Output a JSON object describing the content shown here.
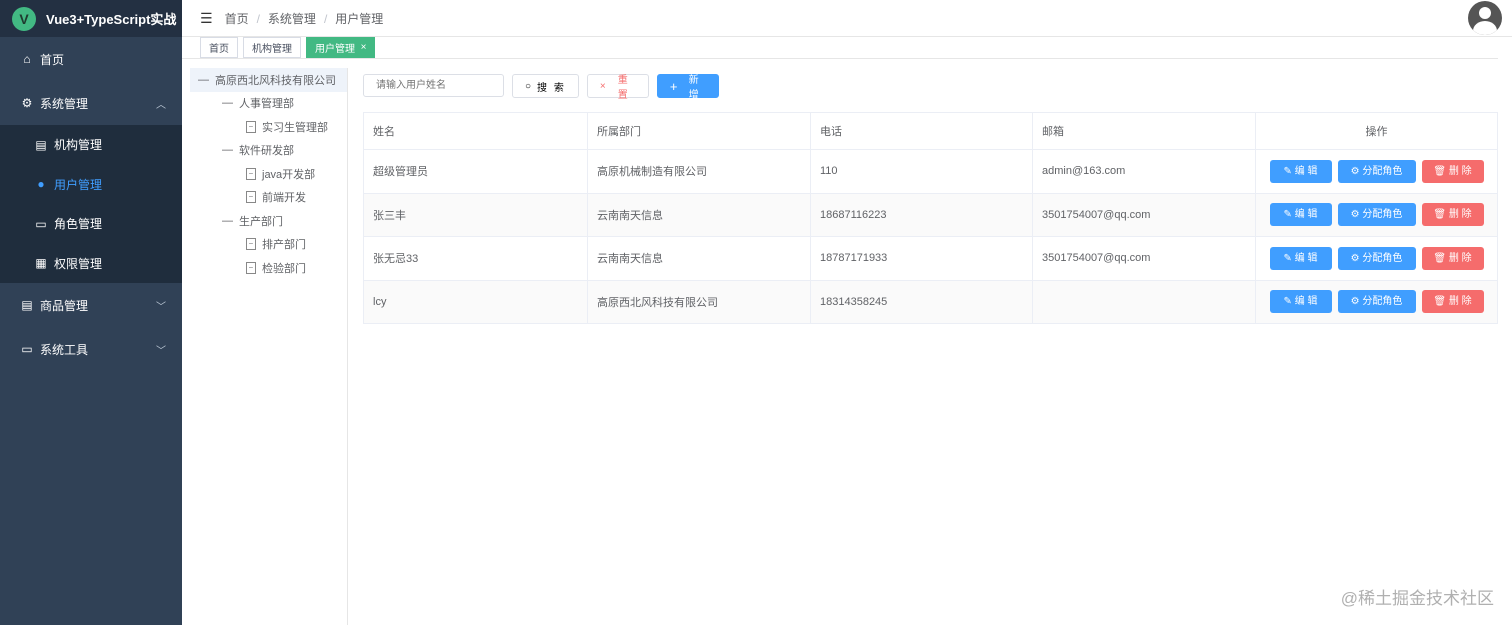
{
  "app": {
    "title": "Vue3+TypeScript实战",
    "logo_letter": "V"
  },
  "sidebar": {
    "items": [
      {
        "label": "首页",
        "icon": "home-icon"
      },
      {
        "label": "系统管理",
        "icon": "gear-icon",
        "expanded": true,
        "children": [
          {
            "label": "机构管理",
            "icon": "clipboard-icon"
          },
          {
            "label": "用户管理",
            "icon": "user-icon",
            "active": true
          },
          {
            "label": "角色管理",
            "icon": "folder-icon"
          },
          {
            "label": "权限管理",
            "icon": "grid-icon"
          }
        ]
      },
      {
        "label": "商品管理",
        "icon": "document-icon"
      },
      {
        "label": "系统工具",
        "icon": "message-icon"
      }
    ]
  },
  "breadcrumb": [
    "首页",
    "系统管理",
    "用户管理"
  ],
  "tabs": [
    {
      "label": "首页"
    },
    {
      "label": "机构管理"
    },
    {
      "label": "用户管理",
      "active": true,
      "close": "×"
    }
  ],
  "tree": [
    {
      "label": "高原西北风科技有限公司",
      "level": 0
    },
    {
      "label": "人事管理部",
      "level": 1
    },
    {
      "label": "实习生管理部",
      "level": 2
    },
    {
      "label": "软件研发部",
      "level": 1
    },
    {
      "label": "java开发部",
      "level": 2
    },
    {
      "label": "前端开发",
      "level": 2
    },
    {
      "label": "生产部门",
      "level": 1
    },
    {
      "label": "排产部门",
      "level": 2
    },
    {
      "label": "检验部门",
      "level": 2
    }
  ],
  "toolbar": {
    "search_placeholder": "请输入用户姓名",
    "search": "搜 索",
    "reset": "重 置",
    "add": "新 增"
  },
  "table": {
    "headers": [
      "姓名",
      "所属部门",
      "电话",
      "邮箱",
      "操作"
    ],
    "rows": [
      [
        "超级管理员",
        "高原机械制造有限公司",
        "110",
        "admin@163.com"
      ],
      [
        "张三丰",
        "云南南天信息",
        "18687116223",
        "3501754007@qq.com"
      ],
      [
        "张无忌33",
        "云南南天信息",
        "18787171933",
        "3501754007@qq.com"
      ],
      [
        "lcy",
        "高原西北风科技有限公司",
        "18314358245",
        ""
      ]
    ],
    "actions": {
      "edit": "编 辑",
      "assign": "分配角色",
      "delete": "删 除"
    }
  },
  "watermark": "@稀土掘金技术社区"
}
